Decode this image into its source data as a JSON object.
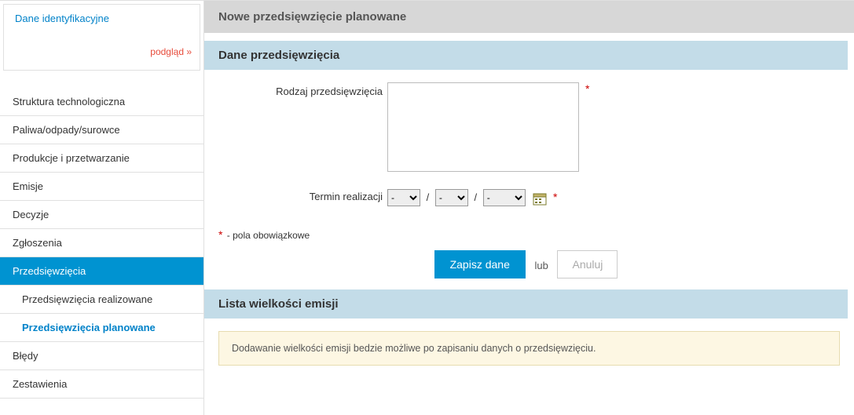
{
  "sidebar": {
    "ident_title": "Dane identyfikacyjne",
    "ident_link": "podgląd »",
    "items": [
      {
        "label": "Struktura technologiczna"
      },
      {
        "label": "Paliwa/odpady/surowce"
      },
      {
        "label": "Produkcje i przetwarzanie"
      },
      {
        "label": "Emisje"
      },
      {
        "label": "Decyzje"
      },
      {
        "label": "Zgłoszenia"
      },
      {
        "label": "Przedsięwzięcia",
        "active": true,
        "subs": [
          {
            "label": "Przedsięwzięcia realizowane"
          },
          {
            "label": "Przedsięwzięcia planowane",
            "active": true
          }
        ]
      },
      {
        "label": "Błędy"
      },
      {
        "label": "Zestawienia"
      }
    ]
  },
  "main": {
    "page_title": "Nowe przedsięwzięcie planowane",
    "section1_title": "Dane przedsięwzięcia",
    "labels": {
      "rodzaj": "Rodzaj przedsięwzięcia",
      "termin": "Termin realizacji"
    },
    "fields": {
      "rodzaj_value": "",
      "day_value": "-",
      "month_value": "-",
      "year_value": "-"
    },
    "required_note": " - pola obowiązkowe",
    "actions": {
      "save": "Zapisz dane",
      "or": "lub",
      "cancel": "Anuluj"
    },
    "section2_title": "Lista wielkości emisji",
    "info": "Dodawanie wielkości emisji bedzie możliwe po zapisaniu danych o przedsięwzięciu."
  }
}
